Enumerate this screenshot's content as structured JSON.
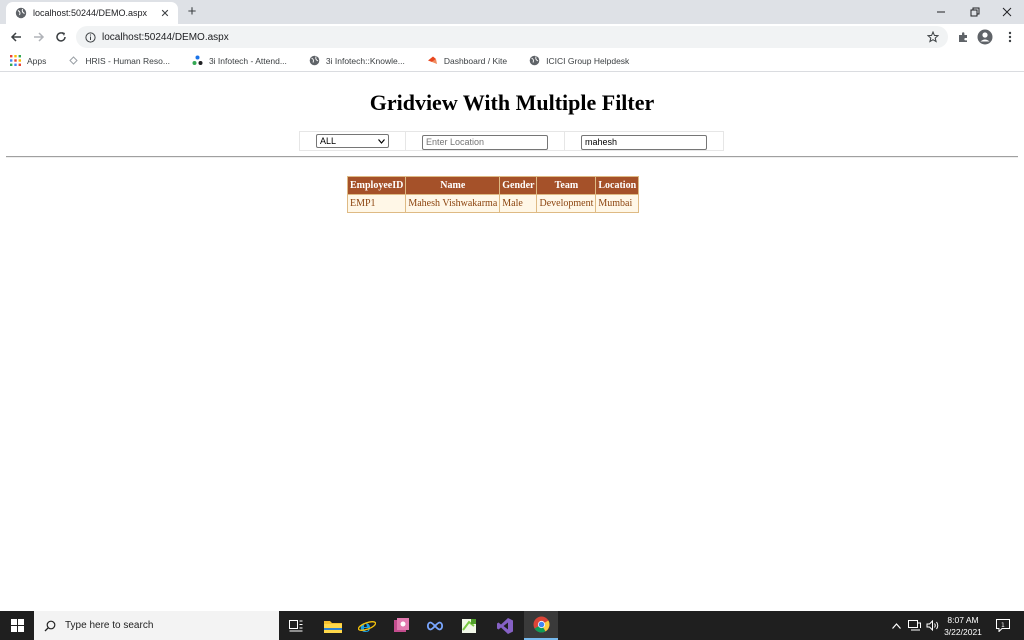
{
  "browser": {
    "tab_title": "localhost:50244/DEMO.aspx",
    "url": "localhost:50244/DEMO.aspx",
    "new_tab_symbol": "+",
    "bookmarks": [
      {
        "label": "Apps",
        "icon": "apps-grid-icon"
      },
      {
        "label": "HRIS - Human Reso...",
        "icon": "hris-icon"
      },
      {
        "label": "3i Infotech - Attend...",
        "icon": "3i-infotech-icon"
      },
      {
        "label": "3i Infotech::Knowle...",
        "icon": "globe-icon"
      },
      {
        "label": "Dashboard / Kite",
        "icon": "kite-icon"
      },
      {
        "label": "ICICI Group Helpdesk",
        "icon": "globe-icon"
      }
    ]
  },
  "page": {
    "title": "Gridview With Multiple Filter",
    "filters": {
      "dropdown_value": "ALL",
      "location_placeholder": "Enter Location",
      "name_value": "mahesh"
    },
    "grid": {
      "headers": [
        "EmployeeID",
        "Name",
        "Gender",
        "Team",
        "Location"
      ],
      "rows": [
        [
          "EMP1",
          "Mahesh Vishwakarma",
          "Male",
          "Development",
          "Mumbai"
        ]
      ]
    }
  },
  "taskbar": {
    "search_placeholder": "Type here to search",
    "time": "8:07 AM",
    "date": "3/22/2021"
  },
  "colors": {
    "grid_header_bg": "#a55129",
    "grid_row_bg": "#fff7e7",
    "grid_text": "#8c4510",
    "grid_border": "#deba84"
  }
}
